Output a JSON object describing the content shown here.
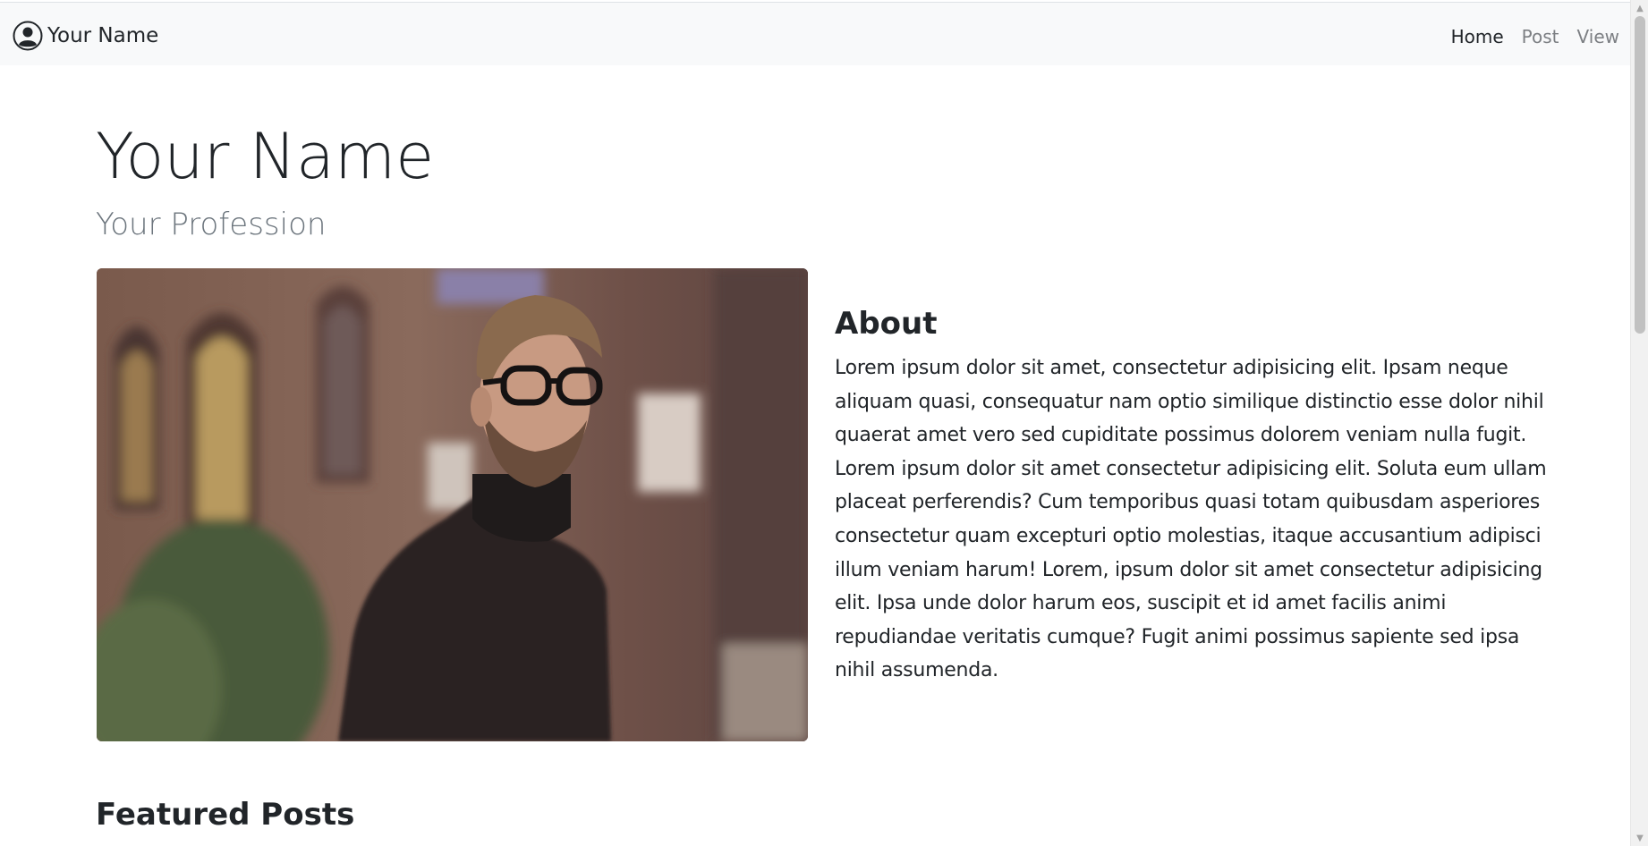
{
  "navbar": {
    "brand_icon": "user-circle-icon",
    "brand_text": "Your Name",
    "links": [
      {
        "label": "Home",
        "active": true
      },
      {
        "label": "Post",
        "active": false
      },
      {
        "label": "View",
        "active": false
      }
    ]
  },
  "hero": {
    "title": "Your Name",
    "subtitle": "Your Profession"
  },
  "about": {
    "heading": "About",
    "text": "Lorem ipsum dolor sit amet, consectetur adipisicing elit. Ipsam neque aliquam quasi, consequatur nam optio similique distinctio esse dolor nihil quaerat amet vero sed cupiditate possimus dolorem veniam nulla fugit. Lorem ipsum dolor sit amet consectetur adipisicing elit. Soluta eum ullam placeat perferendis? Cum temporibus quasi totam quibusdam asperiores consectetur quam excepturi optio molestias, itaque accusantium adipisci illum veniam harum! Lorem, ipsum dolor sit amet consectetur adipisicing elit. Ipsa unde dolor harum eos, suscipit et id amet facilis animi repudiandae veritatis cumque? Fugit animi possimus sapiente sed ipsa nihil assumenda."
  },
  "featured": {
    "heading": "Featured Posts"
  },
  "colors": {
    "navbar_bg": "#f8f9fa",
    "text_primary": "#212529",
    "text_muted": "#6c757d",
    "nav_inactive": "#7c7f83"
  }
}
